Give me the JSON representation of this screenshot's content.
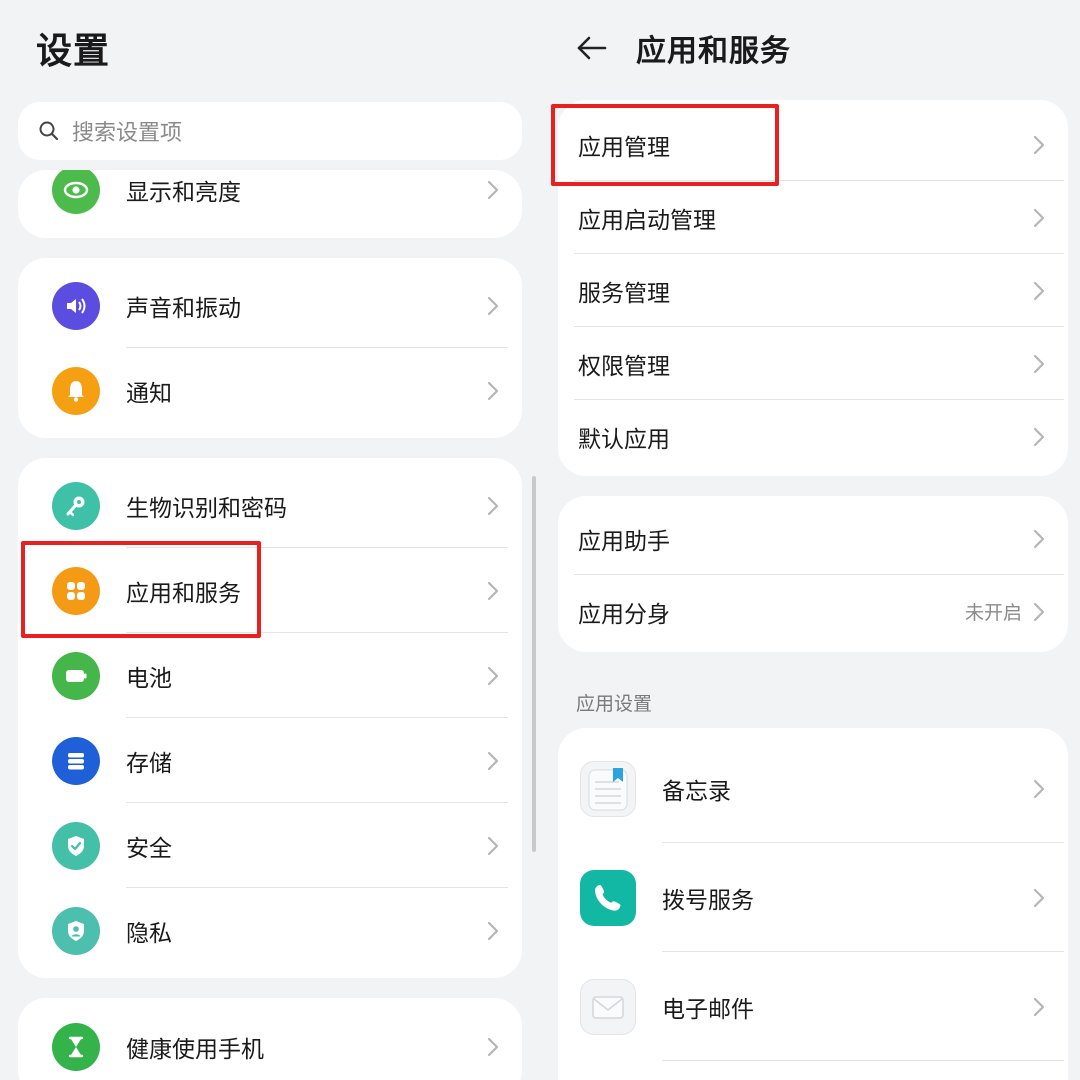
{
  "left": {
    "title": "设置",
    "search": {
      "placeholder": "搜索设置项"
    },
    "items": [
      {
        "label": "显示和亮度",
        "icon": "eye-icon",
        "color": "#4cbb4c"
      },
      {
        "label": "声音和振动",
        "icon": "speaker-icon",
        "color": "#5b4de0"
      },
      {
        "label": "通知",
        "icon": "bell-icon",
        "color": "#f5a012"
      },
      {
        "label": "生物识别和密码",
        "icon": "key-icon",
        "color": "#3fc1a8"
      },
      {
        "label": "应用和服务",
        "icon": "apps-grid-icon",
        "color": "#f59a14"
      },
      {
        "label": "电池",
        "icon": "battery-icon",
        "color": "#45b74a"
      },
      {
        "label": "存储",
        "icon": "storage-icon",
        "color": "#1f5fd8"
      },
      {
        "label": "安全",
        "icon": "shield-check-icon",
        "color": "#45c0a8"
      },
      {
        "label": "隐私",
        "icon": "privacy-shield-icon",
        "color": "#4dbfae"
      },
      {
        "label": "健康使用手机",
        "icon": "hourglass-icon",
        "color": "#34b34a"
      }
    ]
  },
  "right": {
    "title": "应用和服务",
    "group1": [
      {
        "label": "应用管理"
      },
      {
        "label": "应用启动管理"
      },
      {
        "label": "服务管理"
      },
      {
        "label": "权限管理"
      },
      {
        "label": "默认应用"
      }
    ],
    "group2": [
      {
        "label": "应用助手",
        "value": ""
      },
      {
        "label": "应用分身",
        "value": "未开启"
      }
    ],
    "section_label": "应用设置",
    "apps": [
      {
        "label": "备忘录",
        "icon": "notepad-icon"
      },
      {
        "label": "拨号服务",
        "icon": "phone-icon"
      },
      {
        "label": "电子邮件",
        "icon": "mail-icon"
      }
    ]
  },
  "colors": {
    "highlight": "#e8201f",
    "background": "#f1f3f5"
  }
}
